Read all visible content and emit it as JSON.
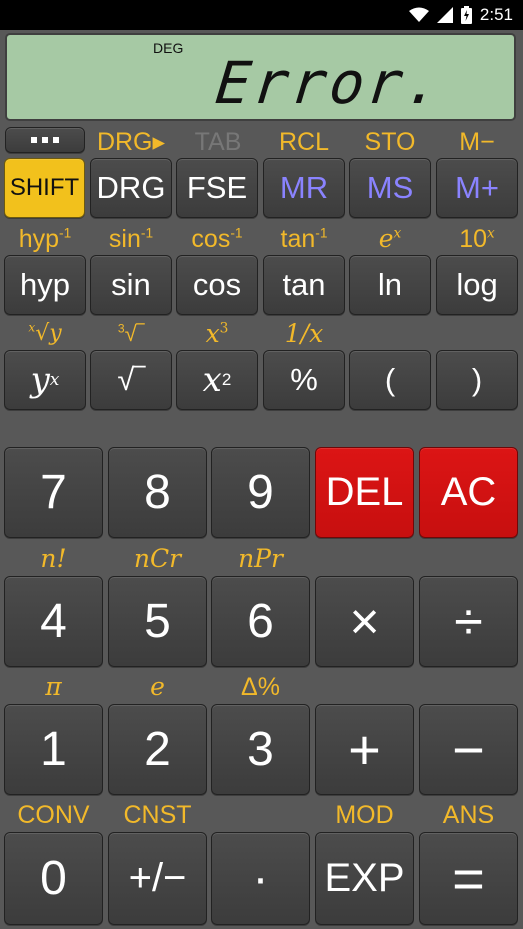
{
  "status_bar": {
    "time": "2:51"
  },
  "display": {
    "angle_mode": "DEG",
    "value": "Error."
  },
  "row1": {
    "labels": [
      "DRG▸",
      "TAB",
      "RCL",
      "STO",
      "M−"
    ],
    "keys": [
      "SHIFT",
      "DRG",
      "FSE",
      "MR",
      "MS",
      "M+"
    ]
  },
  "row2": {
    "labels": [
      {
        "base": "hyp",
        "sup": "-1"
      },
      {
        "base": "sin",
        "sup": "-1"
      },
      {
        "base": "cos",
        "sup": "-1"
      },
      {
        "base": "tan",
        "sup": "-1"
      },
      {
        "base": "e",
        "sup": "x"
      },
      {
        "base": "10",
        "sup": "x"
      }
    ],
    "keys": [
      "hyp",
      "sin",
      "cos",
      "tan",
      "ln",
      "log"
    ]
  },
  "row3": {
    "labels": [
      "x",
      "√y",
      "3",
      "√‾",
      "x",
      "3",
      "1/x"
    ],
    "keys": [
      "y",
      "x",
      "√‾",
      "x",
      "2",
      "%",
      "(",
      ")"
    ]
  },
  "numpad": {
    "row_a_keys": [
      "7",
      "8",
      "9",
      "DEL",
      "AC"
    ],
    "row_b_labels": [
      "n!",
      "nCr",
      "nPr"
    ],
    "row_b_keys": [
      "4",
      "5",
      "6",
      "×",
      "÷"
    ],
    "row_c_labels": [
      "π",
      "e",
      "Δ%"
    ],
    "row_c_keys": [
      "1",
      "2",
      "3",
      "+",
      "−"
    ],
    "row_d_labels": [
      "CONV",
      "CNST",
      "MOD",
      "ANS"
    ],
    "row_d_keys": [
      "0",
      "+/−",
      "·",
      "EXP",
      "="
    ]
  },
  "colors": {
    "display_bg": "#a6c9a4",
    "shift_key": "#f2c11c",
    "memory_text": "#8a83ff",
    "red_key": "#d81313",
    "secondary_label": "#f2b92a"
  }
}
